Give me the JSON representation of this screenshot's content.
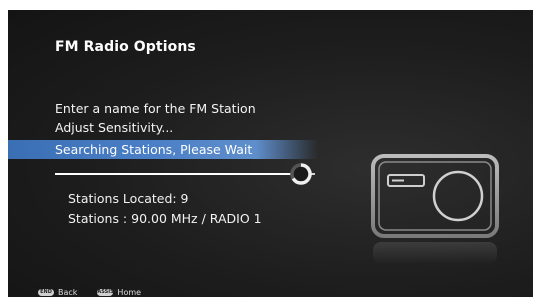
{
  "header": {
    "title": "FM Radio Options"
  },
  "menu": {
    "items": [
      {
        "label": "Enter a name for the FM Station"
      },
      {
        "label": "Adjust Sensitivity..."
      },
      {
        "label": "Searching Stations, Please Wait"
      }
    ]
  },
  "status": {
    "stations_located": "Stations Located: 9",
    "current_station": "Stations : 90.00 MHz / RADIO 1"
  },
  "footer": {
    "back_key": "END",
    "back_label": "Back",
    "home_key": "ASSIST",
    "home_label": "Home"
  },
  "icons": [
    "spinner-icon",
    "radio-icon"
  ],
  "colors": {
    "selected_bg": "#4a7ec6",
    "background": "#1d1d1d",
    "text": "#ffffff"
  }
}
